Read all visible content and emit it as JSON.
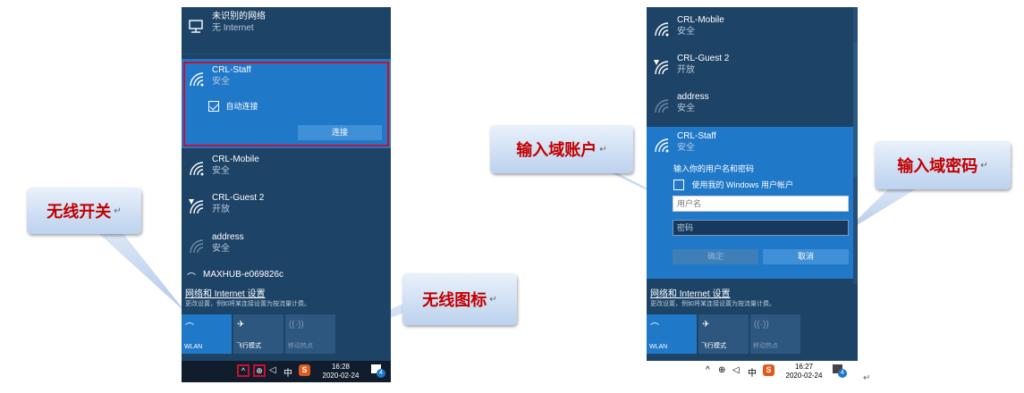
{
  "left": {
    "unidentified": {
      "name": "未识别的网络",
      "status": "无 Internet"
    },
    "selected": {
      "name": "CRL-Staff",
      "status": "安全",
      "auto_connect": "自动连接",
      "connect_button": "连接"
    },
    "networks": [
      {
        "name": "CRL-Mobile",
        "status": "安全"
      },
      {
        "name": "CRL-Guest 2",
        "status": "开放"
      },
      {
        "name": "address",
        "status": "安全"
      },
      {
        "name": "MAXHUB-e069826c",
        "status": ""
      }
    ],
    "settings_link": "网络和 Internet 设置",
    "settings_desc": "更改设置，例如将某连接设置为按流量计费。",
    "tiles": {
      "wlan": "WLAN",
      "airplane": "飞行模式",
      "mobile": "移动热点"
    },
    "taskbar": {
      "ime": "中",
      "time": "16:28",
      "date": "2020-02-24",
      "badge": "4"
    }
  },
  "right": {
    "networks": [
      {
        "name": "CRL-Mobile",
        "status": "安全"
      },
      {
        "name": "CRL-Guest 2",
        "status": "开放"
      },
      {
        "name": "address",
        "status": "安全"
      }
    ],
    "selected": {
      "name": "CRL-Staff",
      "status": "安全",
      "prompt": "输入你的用户名和密码",
      "use_windows_account": "使用我的 Windows 用户帐户",
      "username_placeholder": "用户名",
      "password_placeholder": "密码",
      "ok_button": "确定",
      "cancel_button": "取消"
    },
    "settings_link": "网络和 Internet 设置",
    "settings_desc": "更改设置，例如将某连接设置为按流量计费。",
    "tiles": {
      "wlan": "WLAN",
      "airplane": "飞行模式",
      "mobile": "移动热点"
    },
    "taskbar": {
      "ime": "中",
      "time": "16:27",
      "date": "2020-02-24",
      "badge": "4"
    }
  },
  "callouts": {
    "wireless_switch": "无线开关",
    "wireless_icon": "无线图标",
    "domain_account": "输入域账户",
    "domain_password": "输入域密码",
    "mark": "↵"
  },
  "colors": {
    "panel": "#1d4366",
    "selected": "#1f78c8",
    "highlight": "#c8102e",
    "callout_text": "#c00000"
  }
}
